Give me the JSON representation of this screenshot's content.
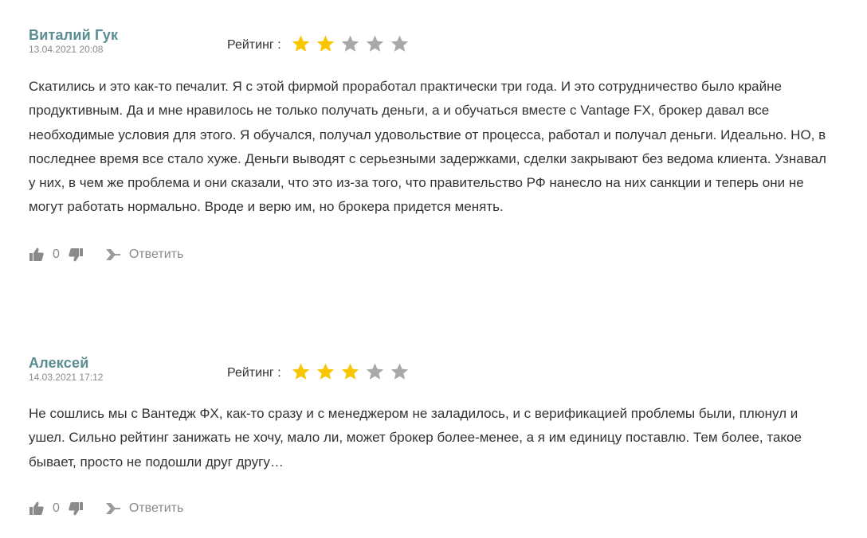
{
  "rating_label": "Рейтинг :",
  "colors": {
    "author": "#5a8d91",
    "star_filled": "#f7c600",
    "star_empty": "#a8a8a8",
    "muted": "#8a8a8a"
  },
  "reviews": [
    {
      "author": "Виталий Гук",
      "date": "13.04.2021 20:08",
      "rating": 2,
      "max_rating": 5,
      "text": "Скатились и это как-то печалит. Я с этой фирмой проработал практически три года. И это сотрудничество было крайне продуктивным. Да и мне нравилось не только получать деньги, а и обучаться вместе с Vantage FX, брокер давал все необходимые условия для этого. Я обучался, получал удовольствие от процесса, работал и получал деньги. Идеально. НО, в последнее время все стало хуже. Деньги выводят с серьезными задержками, сделки закрывают без ведома клиента. Узнавал у них, в чем же проблема и они сказали, что это из-за того, что правительство РФ нанесло на них санкции и теперь они не могут работать нормально. Вроде и верю им, но брокера придется менять.",
      "likes": "0",
      "reply_label": "Ответить"
    },
    {
      "author": "Алексей",
      "date": "14.03.2021 17:12",
      "rating": 3,
      "max_rating": 5,
      "text": "Не сошлись мы с Вантедж ФХ, как-то сразу и с менеджером не заладилось, и с верификацией проблемы были, плюнул и ушел. Сильно рейтинг занижать не хочу, мало ли, может брокер более-менее, а я им единицу поставлю. Тем более, такое бывает, просто не подошли друг другу…",
      "likes": "0",
      "reply_label": "Ответить"
    }
  ]
}
